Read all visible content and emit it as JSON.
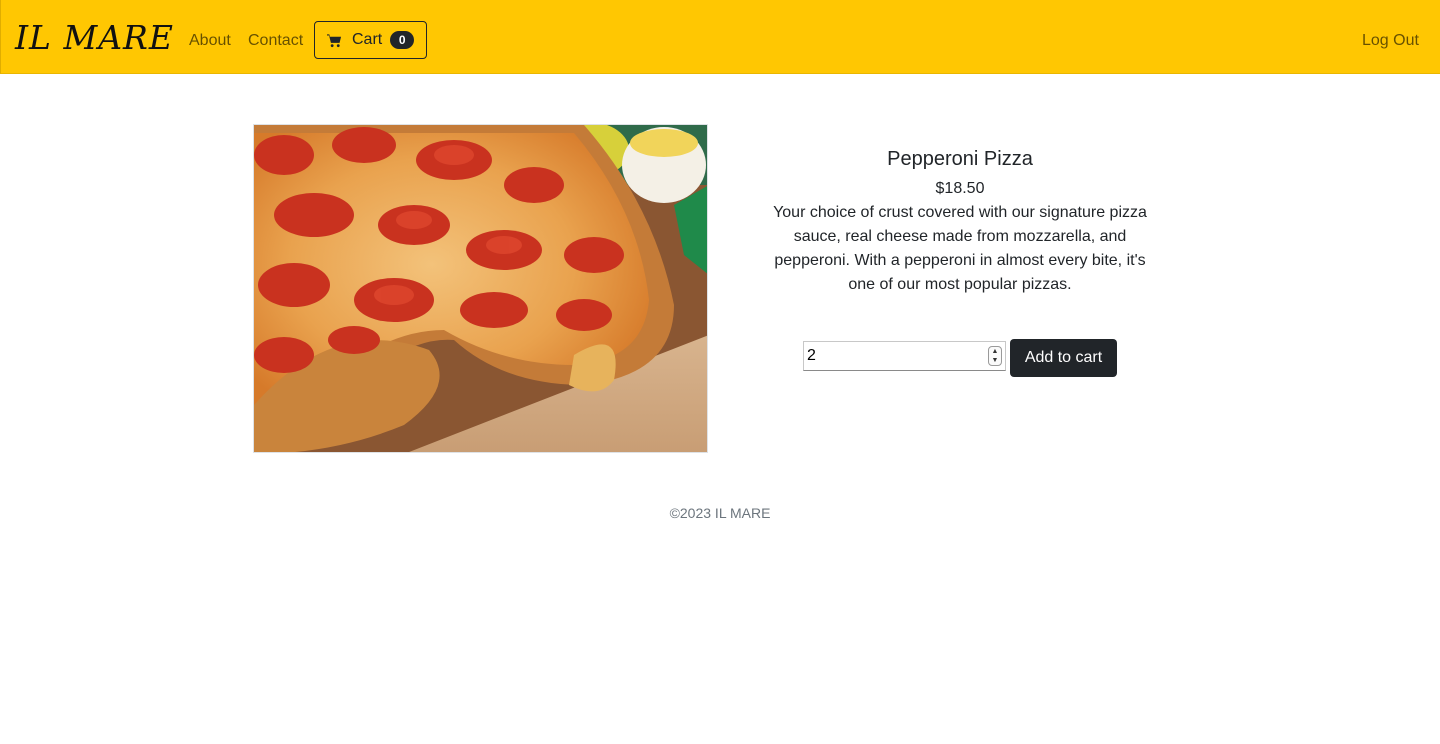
{
  "navbar": {
    "brand": "IL MARE",
    "links": [
      "About",
      "Contact"
    ],
    "cart_label": "Cart",
    "cart_count": "0",
    "logout": "Log Out",
    "background_color": "#ffc702"
  },
  "product": {
    "image_icon": "pepperoni-pizza-photo",
    "title": "Pepperoni Pizza",
    "price": "$18.50",
    "description": "Your choice of crust covered with our signature pizza sauce, real cheese made from mozzarella, and pepperoni. With a pepperoni in almost every bite, it's one of our most popular pizzas.",
    "quantity": "2",
    "add_button": "Add to cart"
  },
  "footer": {
    "text": "©2023 IL MARE"
  }
}
